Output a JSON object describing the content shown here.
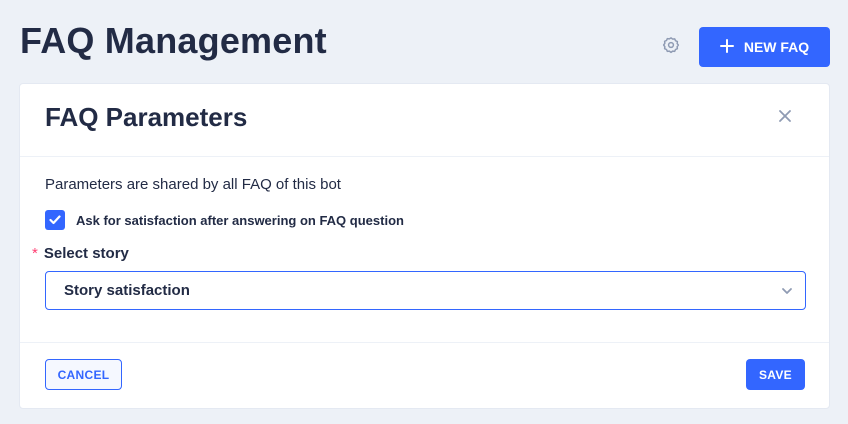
{
  "header": {
    "title": "FAQ Management",
    "settings_icon": "gear-icon",
    "new_faq_label": "NEW FAQ",
    "new_faq_icon": "plus-icon"
  },
  "dialog": {
    "title": "FAQ Parameters",
    "close_icon": "close-icon",
    "info_text": "Parameters are shared by all FAQ of this bot",
    "satisfaction_checkbox": {
      "label": "Ask for satisfaction after answering on FAQ question",
      "checked": true
    },
    "story_field": {
      "required_mark": "*",
      "label": "Select story",
      "value": "Story satisfaction",
      "dropdown_icon": "chevron-down-icon"
    },
    "cancel_label": "CANCEL",
    "save_label": "SAVE"
  },
  "colors": {
    "background": "#edf1f7",
    "primary": "#3366ff",
    "text": "#222b45",
    "required": "#ff3d71"
  }
}
